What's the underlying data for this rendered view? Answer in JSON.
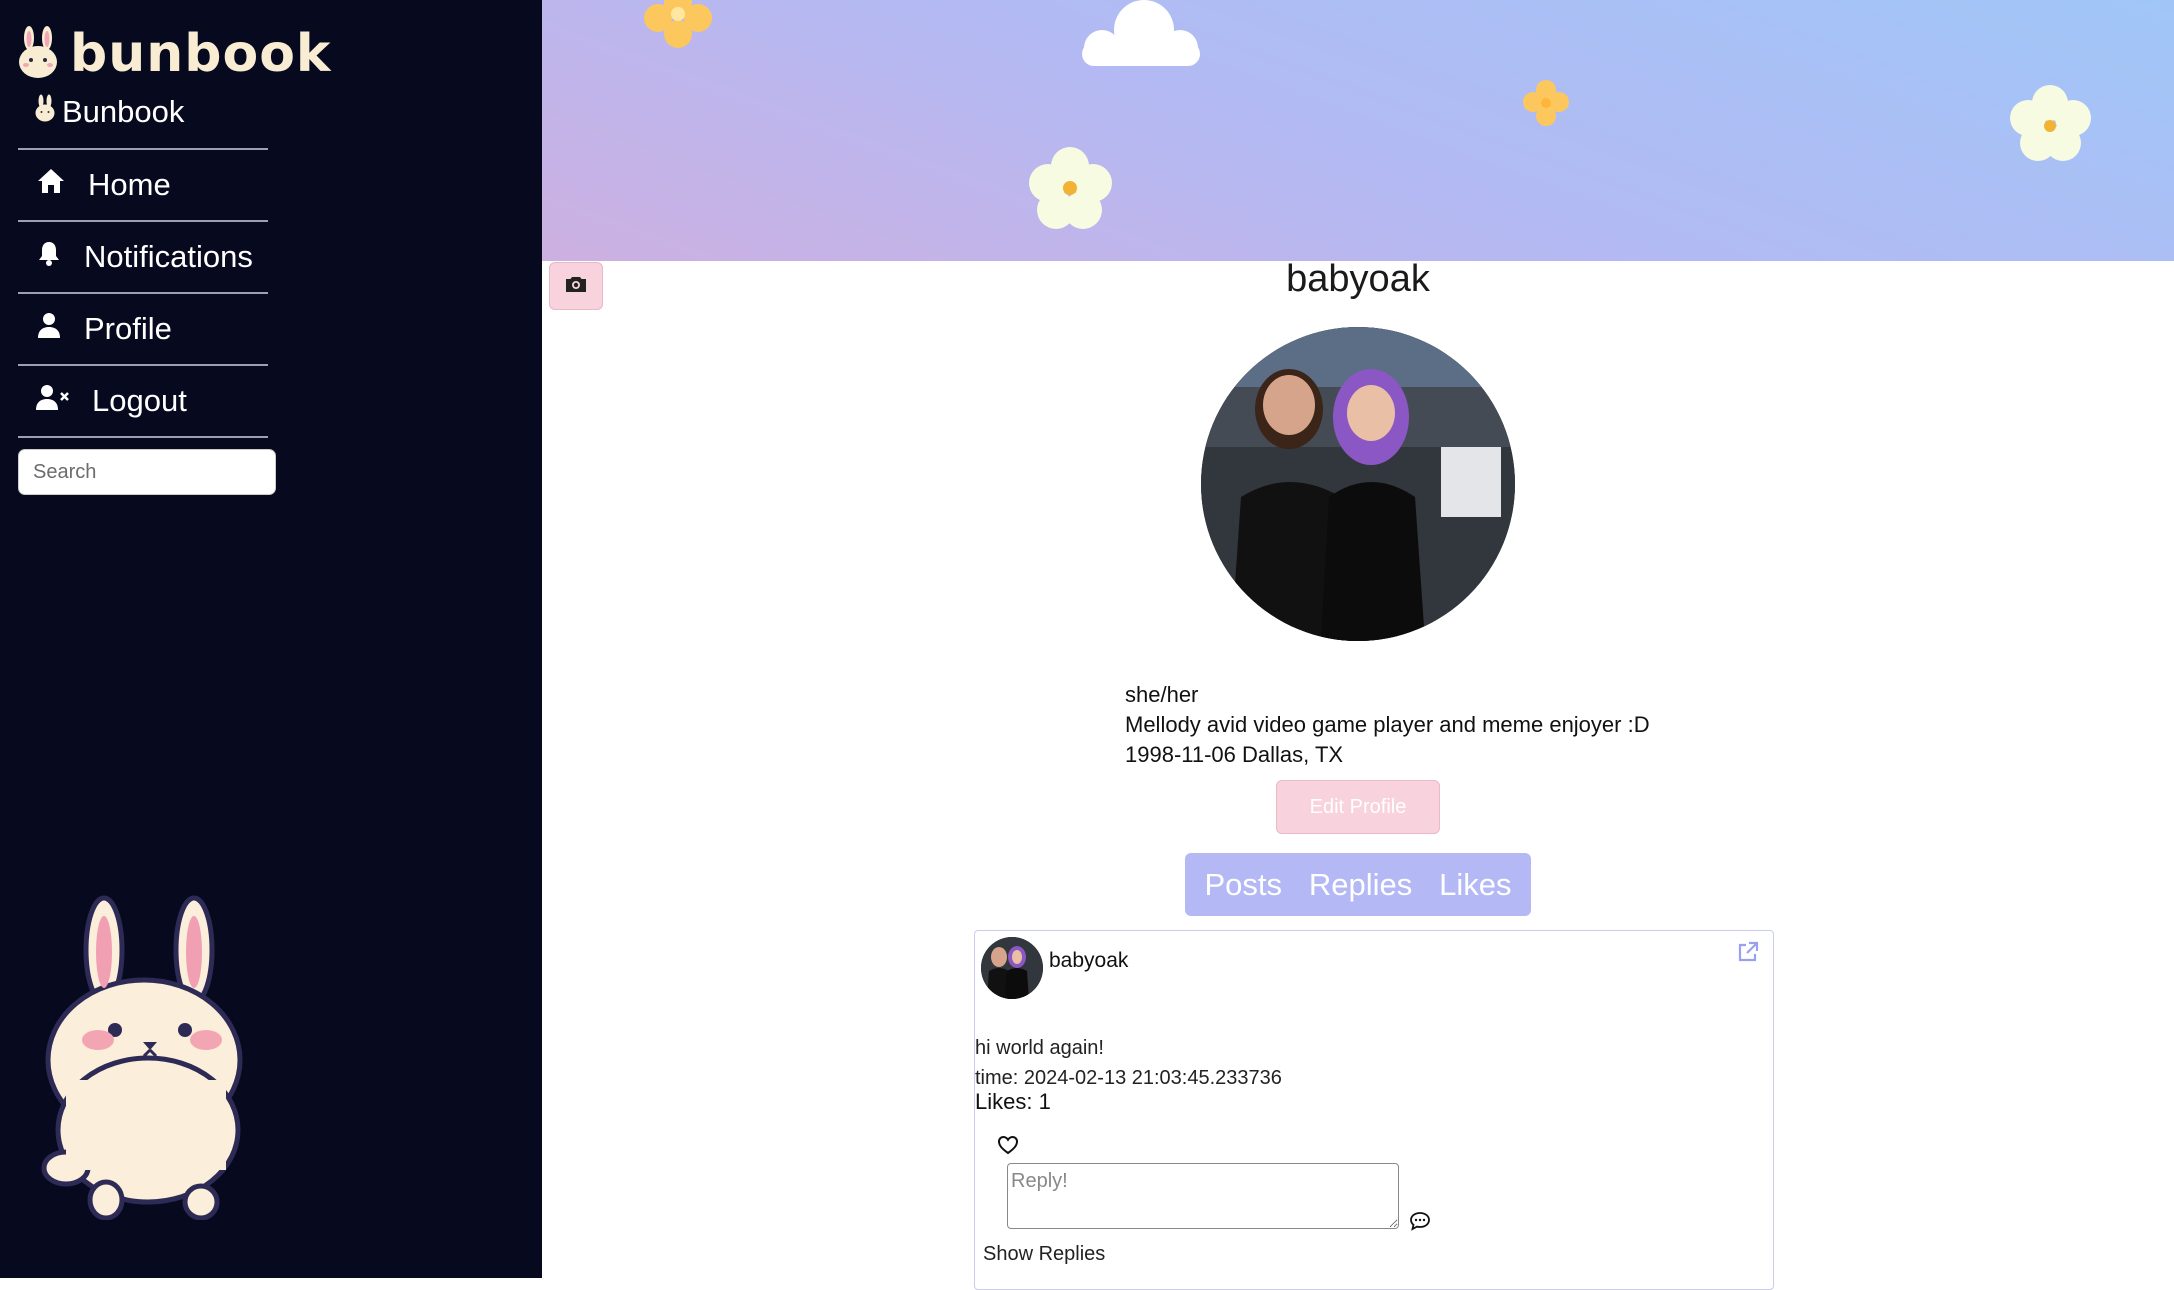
{
  "app": {
    "logo_text": "bunbook",
    "brand_label": "Bunbook"
  },
  "sidebar": {
    "items": [
      {
        "label": "Home",
        "icon": "home-icon"
      },
      {
        "label": "Notifications",
        "icon": "bell-icon"
      },
      {
        "label": "Profile",
        "icon": "user-icon"
      },
      {
        "label": "Logout",
        "icon": "user-x-icon"
      }
    ],
    "search_placeholder": "Search"
  },
  "profile": {
    "username": "babyoak",
    "pronouns": "she/her",
    "bio": "Mellody avid video game player and meme enjoyer :D",
    "birthday_location": "1998-11-06 Dallas, TX",
    "edit_label": "Edit Profile"
  },
  "tabs": [
    "Posts",
    "Replies",
    "Likes"
  ],
  "post": {
    "username": "babyoak",
    "text": "hi world again!",
    "time": "time: 2024-02-13 21:03:45.233736",
    "likes": "Likes: 1",
    "reply_placeholder": "Reply!",
    "show_replies": "Show Replies"
  },
  "colors": {
    "sidebar_bg": "#070a1f",
    "accent_pink": "#f8d2dc",
    "accent_purple": "#b4b9f5"
  }
}
